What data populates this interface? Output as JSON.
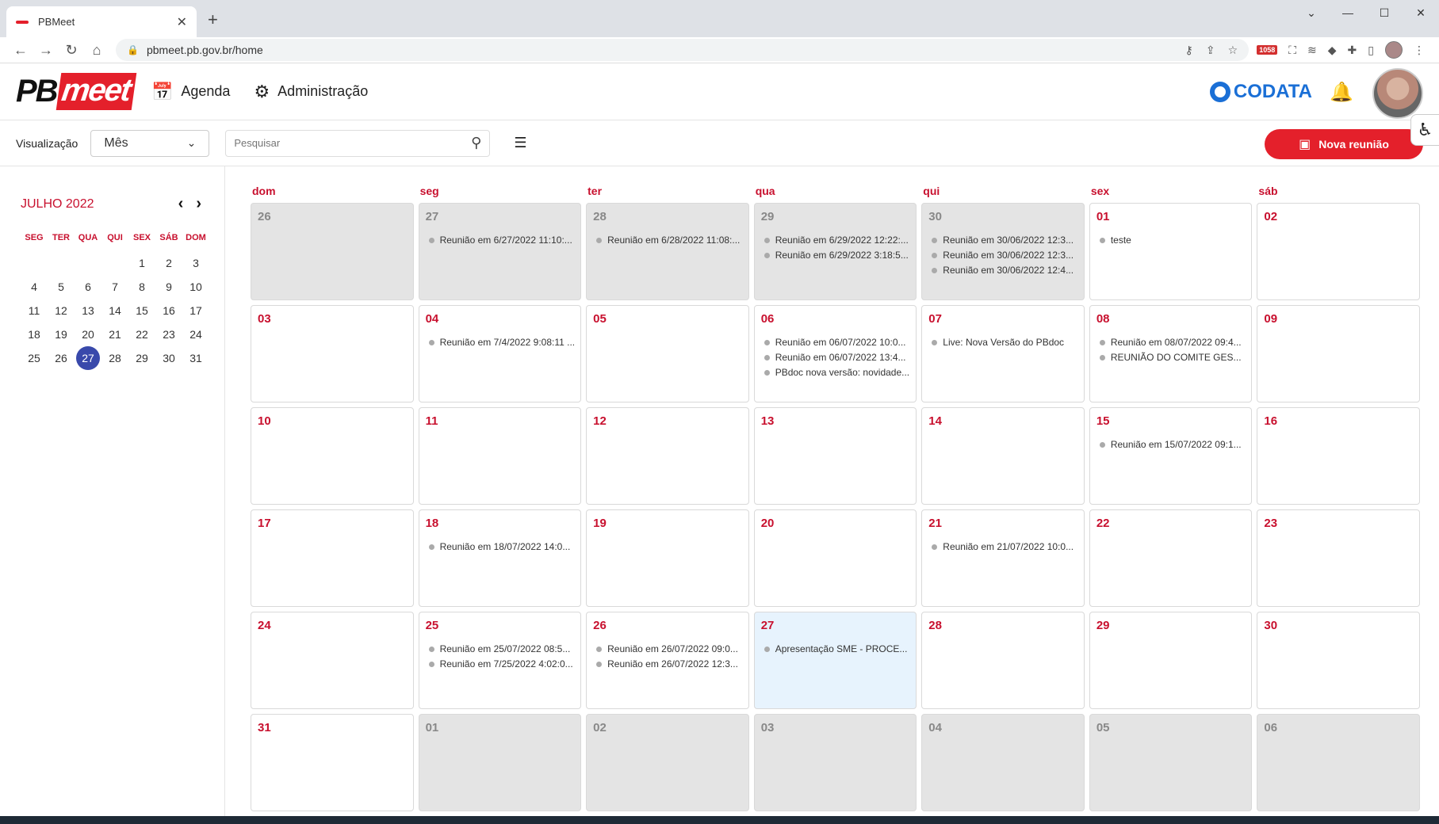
{
  "browser": {
    "tab_title": "PBMeet",
    "new_tab": "+",
    "url": "pbmeet.pb.gov.br/home",
    "ext_badge": "1058"
  },
  "header": {
    "logo_pb": "PB",
    "logo_meet": "meet",
    "nav": [
      {
        "label": "Agenda",
        "icon": "calendar-icon"
      },
      {
        "label": "Administração",
        "icon": "gear-icon"
      }
    ],
    "brand": "CODATA"
  },
  "filters": {
    "view_label": "Visualização",
    "view_value": "Mês",
    "search_placeholder": "Pesquisar",
    "new_meeting_label": "Nova reunião"
  },
  "mini_calendar": {
    "title": "JULHO 2022",
    "weekdays": [
      "SEG",
      "TER",
      "QUA",
      "QUI",
      "SEX",
      "SÁB",
      "DOM"
    ],
    "leading_blanks": 4,
    "days": 31,
    "today": 27
  },
  "calendar": {
    "weekdays": [
      "dom",
      "seg",
      "ter",
      "qua",
      "qui",
      "sex",
      "sáb"
    ],
    "weeks": [
      [
        {
          "day": "26",
          "other": true,
          "events": []
        },
        {
          "day": "27",
          "other": true,
          "events": [
            "Reunião em 6/27/2022 11:10:..."
          ]
        },
        {
          "day": "28",
          "other": true,
          "events": [
            "Reunião em 6/28/2022 11:08:..."
          ]
        },
        {
          "day": "29",
          "other": true,
          "events": [
            "Reunião em 6/29/2022 12:22:...",
            "Reunião em 6/29/2022 3:18:5..."
          ]
        },
        {
          "day": "30",
          "other": true,
          "events": [
            "Reunião em 30/06/2022 12:3...",
            "Reunião em 30/06/2022 12:3...",
            "Reunião em 30/06/2022 12:4..."
          ]
        },
        {
          "day": "01",
          "events": [
            "teste"
          ]
        },
        {
          "day": "02",
          "events": []
        }
      ],
      [
        {
          "day": "03",
          "events": []
        },
        {
          "day": "04",
          "events": [
            "Reunião em 7/4/2022 9:08:11 ..."
          ]
        },
        {
          "day": "05",
          "events": []
        },
        {
          "day": "06",
          "events": [
            "Reunião em 06/07/2022 10:0...",
            "Reunião em 06/07/2022 13:4...",
            "PBdoc nova versão: novidade..."
          ]
        },
        {
          "day": "07",
          "events": [
            "Live: Nova Versão do PBdoc"
          ]
        },
        {
          "day": "08",
          "events": [
            "Reunião em 08/07/2022 09:4...",
            "REUNIÃO DO COMITE GES..."
          ]
        },
        {
          "day": "09",
          "events": []
        }
      ],
      [
        {
          "day": "10",
          "events": []
        },
        {
          "day": "11",
          "events": []
        },
        {
          "day": "12",
          "events": []
        },
        {
          "day": "13",
          "events": []
        },
        {
          "day": "14",
          "events": []
        },
        {
          "day": "15",
          "events": [
            "Reunião em 15/07/2022 09:1..."
          ]
        },
        {
          "day": "16",
          "events": []
        }
      ],
      [
        {
          "day": "17",
          "events": []
        },
        {
          "day": "18",
          "events": [
            "Reunião em 18/07/2022 14:0..."
          ]
        },
        {
          "day": "19",
          "events": []
        },
        {
          "day": "20",
          "events": []
        },
        {
          "day": "21",
          "events": [
            "Reunião em 21/07/2022 10:0..."
          ]
        },
        {
          "day": "22",
          "events": []
        },
        {
          "day": "23",
          "events": []
        }
      ],
      [
        {
          "day": "24",
          "events": []
        },
        {
          "day": "25",
          "events": [
            "Reunião em 25/07/2022 08:5...",
            "Reunião em 7/25/2022 4:02:0..."
          ]
        },
        {
          "day": "26",
          "events": [
            "Reunião em 26/07/2022 09:0...",
            "Reunião em 26/07/2022 12:3..."
          ]
        },
        {
          "day": "27",
          "today": true,
          "events": [
            "Apresentação SME - PROCE..."
          ]
        },
        {
          "day": "28",
          "events": []
        },
        {
          "day": "29",
          "events": []
        },
        {
          "day": "30",
          "events": []
        }
      ],
      [
        {
          "day": "31",
          "events": []
        },
        {
          "day": "01",
          "other": true,
          "events": []
        },
        {
          "day": "02",
          "other": true,
          "events": []
        },
        {
          "day": "03",
          "other": true,
          "events": []
        },
        {
          "day": "04",
          "other": true,
          "events": []
        },
        {
          "day": "05",
          "other": true,
          "events": []
        },
        {
          "day": "06",
          "other": true,
          "events": []
        }
      ]
    ]
  }
}
